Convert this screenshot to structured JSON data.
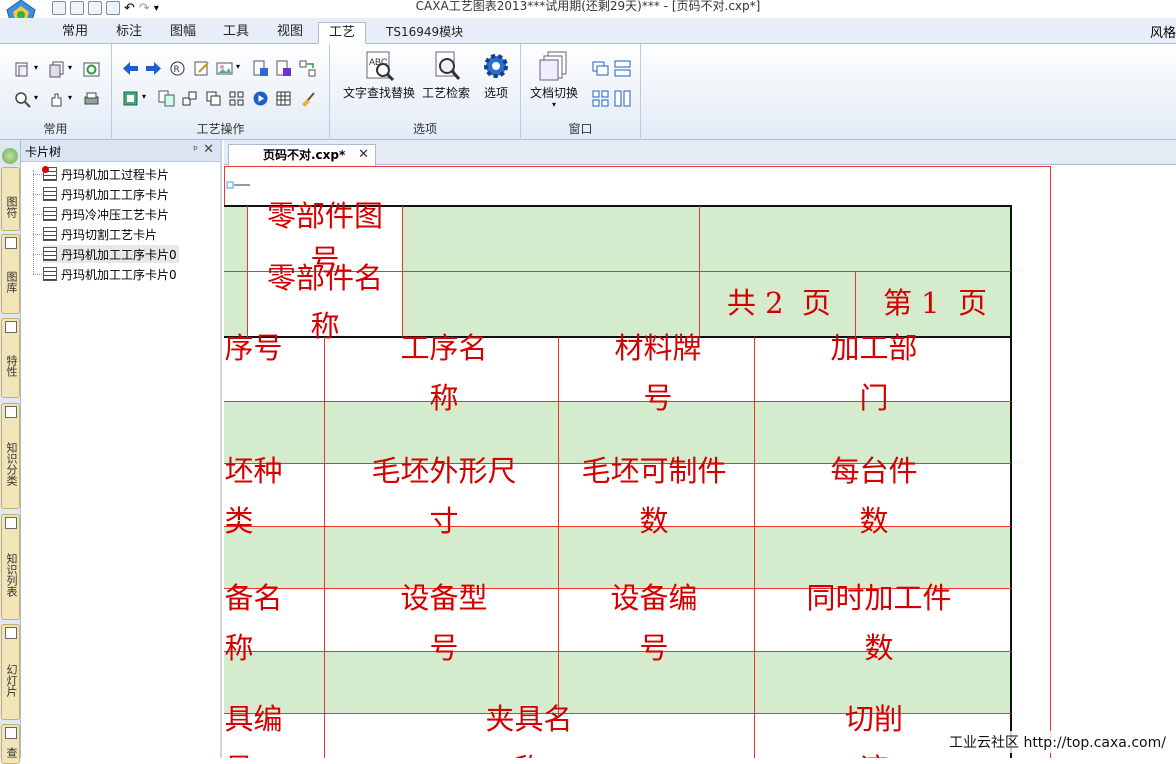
{
  "window": {
    "title": "CAXA工艺图表2013***试用期(还剩29天)*** - [页码不对.cxp*]",
    "user": "风格"
  },
  "ribbon": {
    "tabs": [
      {
        "label": "常用"
      },
      {
        "label": "标注"
      },
      {
        "label": "图幅"
      },
      {
        "label": "工具"
      },
      {
        "label": "视图"
      },
      {
        "label": "工艺",
        "active": true
      },
      {
        "label": "TS16949模块"
      }
    ],
    "groups": {
      "common": "常用",
      "process_ops": "工艺操作",
      "options": "选项",
      "window": "窗口"
    },
    "buttons": {
      "find_replace": "文字查找替换",
      "process_search": "工艺检索",
      "options": "选项",
      "doc_switch": "文档切换"
    }
  },
  "side_tabs": [
    "图符",
    "图库",
    "特性",
    "知识分类",
    "知识列表",
    "幻灯片",
    "查"
  ],
  "card_tree": {
    "title": "卡片树",
    "items": [
      {
        "label": "丹玛机加工过程卡片",
        "icon": "process-card-icon"
      },
      {
        "label": "丹玛机加工工序卡片",
        "icon": "operation-card-icon"
      },
      {
        "label": "丹玛冷冲压工艺卡片",
        "icon": "operation-card-icon"
      },
      {
        "label": "丹玛切割工艺卡片",
        "icon": "operation-card-icon"
      },
      {
        "label": "丹玛机加工工序卡片0",
        "icon": "operation-card-icon",
        "selected": true
      },
      {
        "label": "丹玛机加工工序卡片0",
        "icon": "operation-card-icon"
      }
    ]
  },
  "document": {
    "tab_label": "页码不对.cxp*"
  },
  "card": {
    "part_no": "零部件图号",
    "part_name": "零部件名称",
    "total_pages": "共 2  页",
    "page_no": "第 1  页",
    "row1": [
      "工序号",
      "工序名称",
      "材料牌号",
      "加工部门"
    ],
    "row2": [
      "毛坯种类",
      "毛坯外形尺寸",
      "毛坯可制件数",
      "每台件数"
    ],
    "row3": [
      "设备名称",
      "设备型号",
      "设备编号",
      "同时加工件数"
    ],
    "row4": [
      "夹具编号",
      "夹具名称",
      "",
      "切削液"
    ]
  },
  "watermark": "工业云社区 http://top.caxa.com/",
  "colors": {
    "card_line": "#ee3333",
    "card_text": "#d40000",
    "cell_fill": "#d5ebcd",
    "ribbon_bg": "#e3ebf6"
  }
}
